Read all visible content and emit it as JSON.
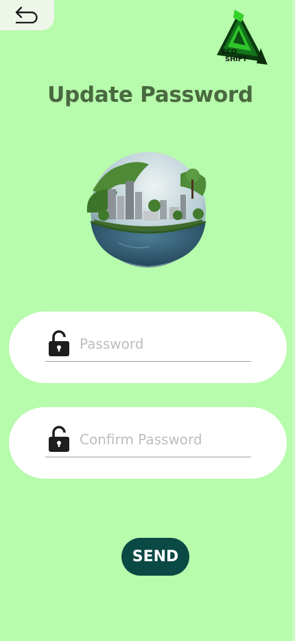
{
  "header": {
    "back_icon": "back-arrow-icon",
    "logo": {
      "line1": "ECO",
      "line2": "SHIFT"
    }
  },
  "page": {
    "title": "Update Password"
  },
  "form": {
    "password": {
      "placeholder": "Password",
      "icon": "lock-icon"
    },
    "confirm_password": {
      "placeholder": "Confirm Password",
      "icon": "lock-icon"
    },
    "send_label": "SEND"
  },
  "colors": {
    "background": "#b7fbac",
    "title": "#49693f",
    "button": "#0b4a44",
    "card": "#ffffff"
  }
}
